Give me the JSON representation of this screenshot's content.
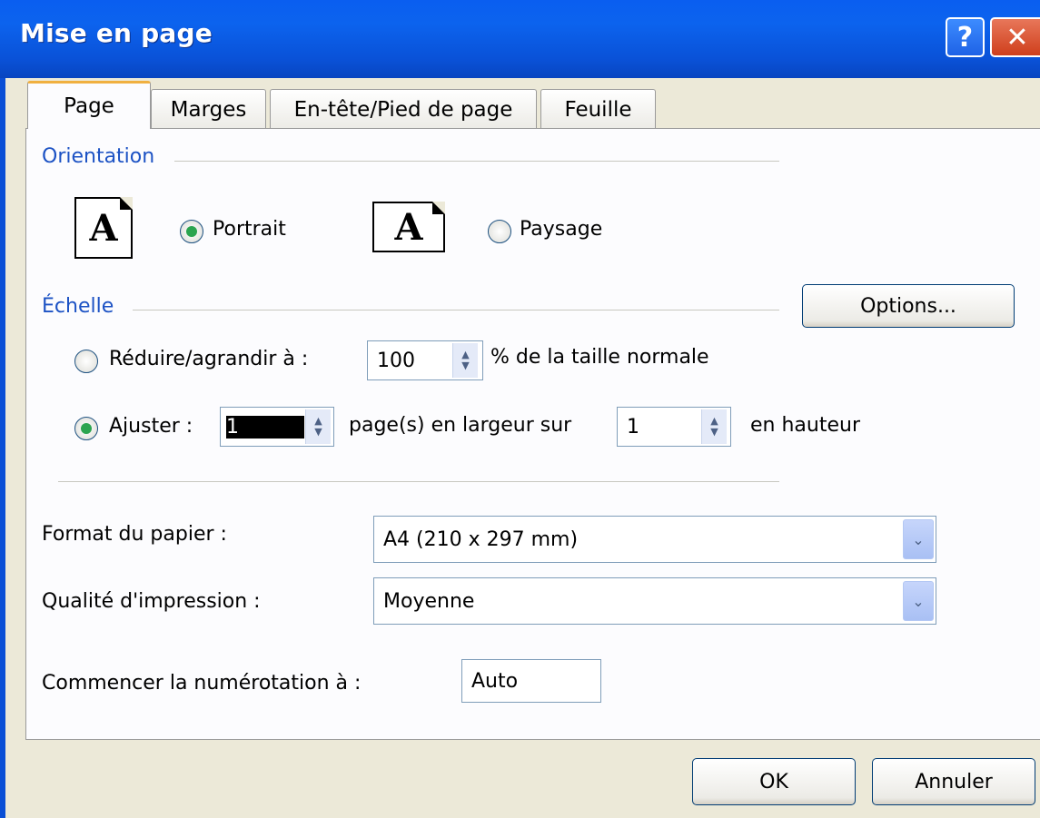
{
  "window": {
    "title": "Mise en page",
    "help_glyph": "?",
    "close_glyph": "✕"
  },
  "tabs": [
    {
      "label": "Page",
      "active": true
    },
    {
      "label": "Marges",
      "active": false
    },
    {
      "label": "En-tête/Pied de page",
      "active": false
    },
    {
      "label": "Feuille",
      "active": false
    }
  ],
  "orientation": {
    "group_label": "Orientation",
    "portrait": {
      "label": "Portrait",
      "selected": true,
      "icon": "A"
    },
    "landscape": {
      "label": "Paysage",
      "selected": false,
      "icon": "A"
    }
  },
  "scale": {
    "group_label": "Échelle",
    "options_button": "Options...",
    "reduce": {
      "label": "Réduire/agrandir à :",
      "selected": false,
      "value": "100",
      "suffix": "% de la taille normale"
    },
    "fit": {
      "label": "Ajuster :",
      "selected": true,
      "wide_value": "1",
      "wide_suffix": "page(s) en largeur sur",
      "tall_value": "1",
      "tall_suffix": "en hauteur"
    }
  },
  "paper": {
    "label": "Format du papier :",
    "value": "A4 (210 x 297 mm)"
  },
  "quality": {
    "label": "Qualité d'impression :",
    "value": "Moyenne"
  },
  "numbering": {
    "label": "Commencer la numérotation à :",
    "value": "Auto"
  },
  "footer": {
    "ok": "OK",
    "cancel": "Annuler"
  },
  "colors": {
    "titlebar": "#0a5ef0",
    "frame": "#ece9d8",
    "group_title": "#1c52c4",
    "radio_dot": "#2ba44f"
  }
}
